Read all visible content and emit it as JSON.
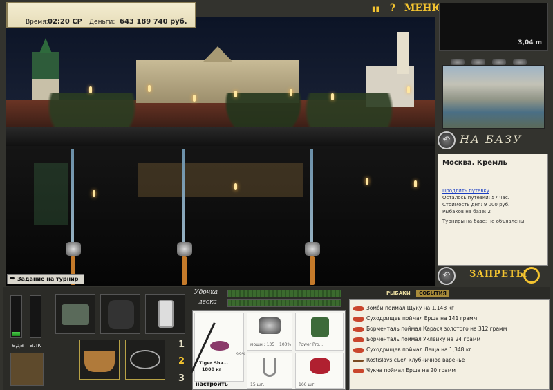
{
  "hud": {
    "time_label": "Время:",
    "time_value": "02:20 СР",
    "money_label": "Деньги:",
    "money_value": "643 189 740 руб."
  },
  "menu": {
    "pause_icon": "pause-icon",
    "help_label": "?",
    "menu_label": "МЕНЮ"
  },
  "depth": {
    "value": "3,04 m"
  },
  "base_button": {
    "label": "НА БАЗУ"
  },
  "location": {
    "title": "Москва. Кремль",
    "extend_link": "Продлить путевку",
    "lines": [
      "Осталось путевки: 57 час.",
      "Стоимость дня: 9 000 руб.",
      "Рыбаков на базе: 2",
      "Турниры на базе: не объявлены"
    ]
  },
  "bans_button": {
    "label": "ЗАПРЕТЫ"
  },
  "task_bar": {
    "label": "Задание на турнир"
  },
  "needs": {
    "food_label": "еда",
    "alcohol_label": "алк",
    "food_level": 0.1,
    "alcohol_level": 0.0
  },
  "tackle_labels": {
    "rod": "Удочка",
    "line": "леска"
  },
  "rod_sets": [
    "1",
    "2",
    "3"
  ],
  "active_rod_set": "2",
  "tackle": {
    "rod_name": "Tiger Sha...",
    "rod_weight": "1800 кг",
    "rod_wear": "99%",
    "reel_stats": "мощн.: 135",
    "reel_wear": "100%",
    "line_name": "Power Pro...",
    "hook_count": "15 шт.",
    "bait_count": "166 шт.",
    "setup_label": "настроить"
  },
  "news": {
    "tabs": [
      "РЫБАКИ",
      "СОБЫТИЯ"
    ],
    "active_tab": "СОБЫТИЯ",
    "items": [
      {
        "icon": "fish-icon",
        "text": "Зомби поймал Щуку на 1,148 кг"
      },
      {
        "icon": "fish-icon",
        "text": "Суходрищев поймал Ерша на 141 грамм"
      },
      {
        "icon": "fish-icon",
        "text": "Борменталь поймал Карася золотого на 312 грамм"
      },
      {
        "icon": "fish-icon",
        "text": "Борменталь поймал Уклейку на 24 грамм"
      },
      {
        "icon": "fish-icon",
        "text": "Суходрищев поймал Леща на 1,348 кг"
      },
      {
        "icon": "spoon-icon",
        "text": "Rostislavs съел клубничное варенье"
      },
      {
        "icon": "fish-icon",
        "text": "Чукча поймал Ерша на 20 грамм"
      }
    ]
  },
  "colors": {
    "accent": "#f4c430",
    "panel_bg": "#f3efe2",
    "link": "#1a3ec4"
  }
}
